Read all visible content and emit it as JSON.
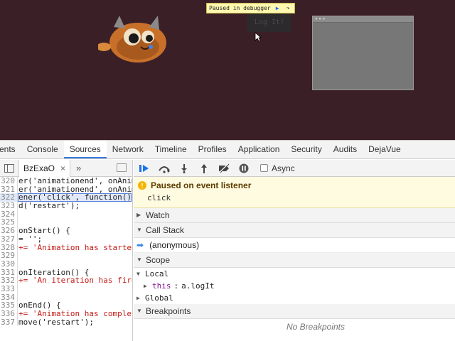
{
  "page": {
    "paused_banner": "Paused in debugger",
    "log_button": "Log It!",
    "colors": {
      "page_bg": "#3a1f27",
      "banner_bg": "#fff8b0",
      "accent": "#3879d9"
    }
  },
  "devtools": {
    "tabs": [
      {
        "label": "ents"
      },
      {
        "label": "Console"
      },
      {
        "label": "Sources"
      },
      {
        "label": "Network"
      },
      {
        "label": "Timeline"
      },
      {
        "label": "Profiles"
      },
      {
        "label": "Application"
      },
      {
        "label": "Security"
      },
      {
        "label": "Audits"
      },
      {
        "label": "DejaVue"
      }
    ],
    "active_tab": "Sources",
    "file_tab": "BzExaO",
    "more_tabs": "»",
    "code_lines": [
      {
        "num": "321",
        "text": "er('animationend', onAnim"
      },
      {
        "num": "322",
        "text": "ener('click', function()"
      },
      {
        "num": "323",
        "text": "d('restart');"
      },
      {
        "num": "324",
        "text": ""
      },
      {
        "num": "325",
        "text": ""
      },
      {
        "num": "326",
        "text": "onStart() {"
      },
      {
        "num": "327",
        "text": "= '';"
      },
      {
        "num": "328",
        "text": "+= 'Animation has started"
      },
      {
        "num": "329",
        "text": ""
      },
      {
        "num": "330",
        "text": ""
      },
      {
        "num": "331",
        "text": "onIteration() {"
      },
      {
        "num": "332",
        "text": "+= 'An iteration has fire"
      },
      {
        "num": "333",
        "text": ""
      },
      {
        "num": "334",
        "text": ""
      },
      {
        "num": "335",
        "text": "onEnd() {"
      },
      {
        "num": "336",
        "text": "+= 'Animation has complet"
      },
      {
        "num": "337",
        "text": "move('restart');"
      }
    ],
    "partial_top_line": {
      "num": "320",
      "text": "er('animationend', onAnim"
    },
    "async_label": "Async",
    "paused": {
      "title": "Paused on event listener",
      "detail": "click"
    },
    "sections": {
      "watch": "Watch",
      "call_stack": "Call Stack",
      "scope": "Scope",
      "breakpoints": "Breakpoints"
    },
    "call_stack_frames": [
      "(anonymous)"
    ],
    "scope": {
      "local_label": "Local",
      "this_name": "this",
      "this_value": "a.logIt",
      "global_label": "Global"
    },
    "no_breakpoints": "No Breakpoints"
  }
}
